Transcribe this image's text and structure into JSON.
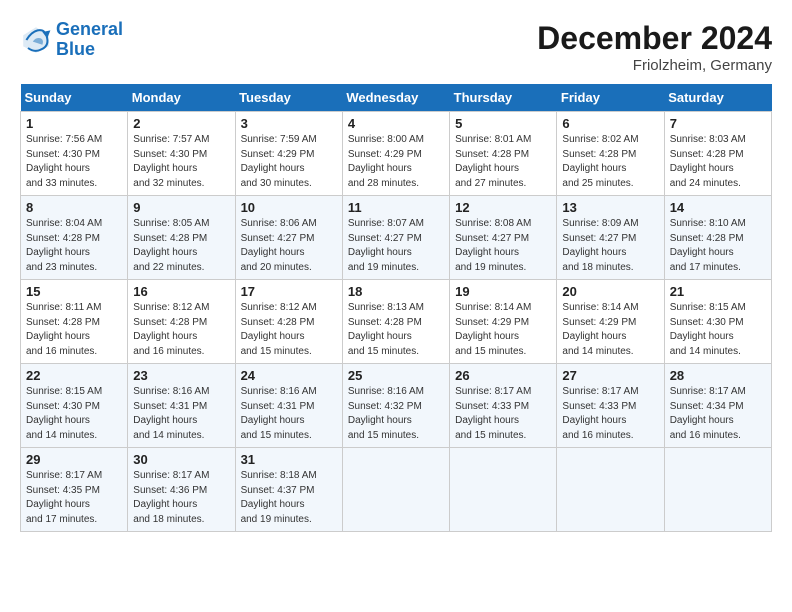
{
  "header": {
    "logo_line1": "General",
    "logo_line2": "Blue",
    "month_title": "December 2024",
    "location": "Friolzheim, Germany"
  },
  "days_of_week": [
    "Sunday",
    "Monday",
    "Tuesday",
    "Wednesday",
    "Thursday",
    "Friday",
    "Saturday"
  ],
  "weeks": [
    [
      {
        "num": "1",
        "sunrise": "7:56 AM",
        "sunset": "4:30 PM",
        "daylight": "8 hours and 33 minutes."
      },
      {
        "num": "2",
        "sunrise": "7:57 AM",
        "sunset": "4:30 PM",
        "daylight": "8 hours and 32 minutes."
      },
      {
        "num": "3",
        "sunrise": "7:59 AM",
        "sunset": "4:29 PM",
        "daylight": "8 hours and 30 minutes."
      },
      {
        "num": "4",
        "sunrise": "8:00 AM",
        "sunset": "4:29 PM",
        "daylight": "8 hours and 28 minutes."
      },
      {
        "num": "5",
        "sunrise": "8:01 AM",
        "sunset": "4:28 PM",
        "daylight": "8 hours and 27 minutes."
      },
      {
        "num": "6",
        "sunrise": "8:02 AM",
        "sunset": "4:28 PM",
        "daylight": "8 hours and 25 minutes."
      },
      {
        "num": "7",
        "sunrise": "8:03 AM",
        "sunset": "4:28 PM",
        "daylight": "8 hours and 24 minutes."
      }
    ],
    [
      {
        "num": "8",
        "sunrise": "8:04 AM",
        "sunset": "4:28 PM",
        "daylight": "8 hours and 23 minutes."
      },
      {
        "num": "9",
        "sunrise": "8:05 AM",
        "sunset": "4:28 PM",
        "daylight": "8 hours and 22 minutes."
      },
      {
        "num": "10",
        "sunrise": "8:06 AM",
        "sunset": "4:27 PM",
        "daylight": "8 hours and 20 minutes."
      },
      {
        "num": "11",
        "sunrise": "8:07 AM",
        "sunset": "4:27 PM",
        "daylight": "8 hours and 19 minutes."
      },
      {
        "num": "12",
        "sunrise": "8:08 AM",
        "sunset": "4:27 PM",
        "daylight": "8 hours and 19 minutes."
      },
      {
        "num": "13",
        "sunrise": "8:09 AM",
        "sunset": "4:27 PM",
        "daylight": "8 hours and 18 minutes."
      },
      {
        "num": "14",
        "sunrise": "8:10 AM",
        "sunset": "4:28 PM",
        "daylight": "8 hours and 17 minutes."
      }
    ],
    [
      {
        "num": "15",
        "sunrise": "8:11 AM",
        "sunset": "4:28 PM",
        "daylight": "8 hours and 16 minutes."
      },
      {
        "num": "16",
        "sunrise": "8:12 AM",
        "sunset": "4:28 PM",
        "daylight": "8 hours and 16 minutes."
      },
      {
        "num": "17",
        "sunrise": "8:12 AM",
        "sunset": "4:28 PM",
        "daylight": "8 hours and 15 minutes."
      },
      {
        "num": "18",
        "sunrise": "8:13 AM",
        "sunset": "4:28 PM",
        "daylight": "8 hours and 15 minutes."
      },
      {
        "num": "19",
        "sunrise": "8:14 AM",
        "sunset": "4:29 PM",
        "daylight": "8 hours and 15 minutes."
      },
      {
        "num": "20",
        "sunrise": "8:14 AM",
        "sunset": "4:29 PM",
        "daylight": "8 hours and 14 minutes."
      },
      {
        "num": "21",
        "sunrise": "8:15 AM",
        "sunset": "4:30 PM",
        "daylight": "8 hours and 14 minutes."
      }
    ],
    [
      {
        "num": "22",
        "sunrise": "8:15 AM",
        "sunset": "4:30 PM",
        "daylight": "8 hours and 14 minutes."
      },
      {
        "num": "23",
        "sunrise": "8:16 AM",
        "sunset": "4:31 PM",
        "daylight": "8 hours and 14 minutes."
      },
      {
        "num": "24",
        "sunrise": "8:16 AM",
        "sunset": "4:31 PM",
        "daylight": "8 hours and 15 minutes."
      },
      {
        "num": "25",
        "sunrise": "8:16 AM",
        "sunset": "4:32 PM",
        "daylight": "8 hours and 15 minutes."
      },
      {
        "num": "26",
        "sunrise": "8:17 AM",
        "sunset": "4:33 PM",
        "daylight": "8 hours and 15 minutes."
      },
      {
        "num": "27",
        "sunrise": "8:17 AM",
        "sunset": "4:33 PM",
        "daylight": "8 hours and 16 minutes."
      },
      {
        "num": "28",
        "sunrise": "8:17 AM",
        "sunset": "4:34 PM",
        "daylight": "8 hours and 16 minutes."
      }
    ],
    [
      {
        "num": "29",
        "sunrise": "8:17 AM",
        "sunset": "4:35 PM",
        "daylight": "8 hours and 17 minutes."
      },
      {
        "num": "30",
        "sunrise": "8:17 AM",
        "sunset": "4:36 PM",
        "daylight": "8 hours and 18 minutes."
      },
      {
        "num": "31",
        "sunrise": "8:18 AM",
        "sunset": "4:37 PM",
        "daylight": "8 hours and 19 minutes."
      },
      null,
      null,
      null,
      null
    ]
  ]
}
